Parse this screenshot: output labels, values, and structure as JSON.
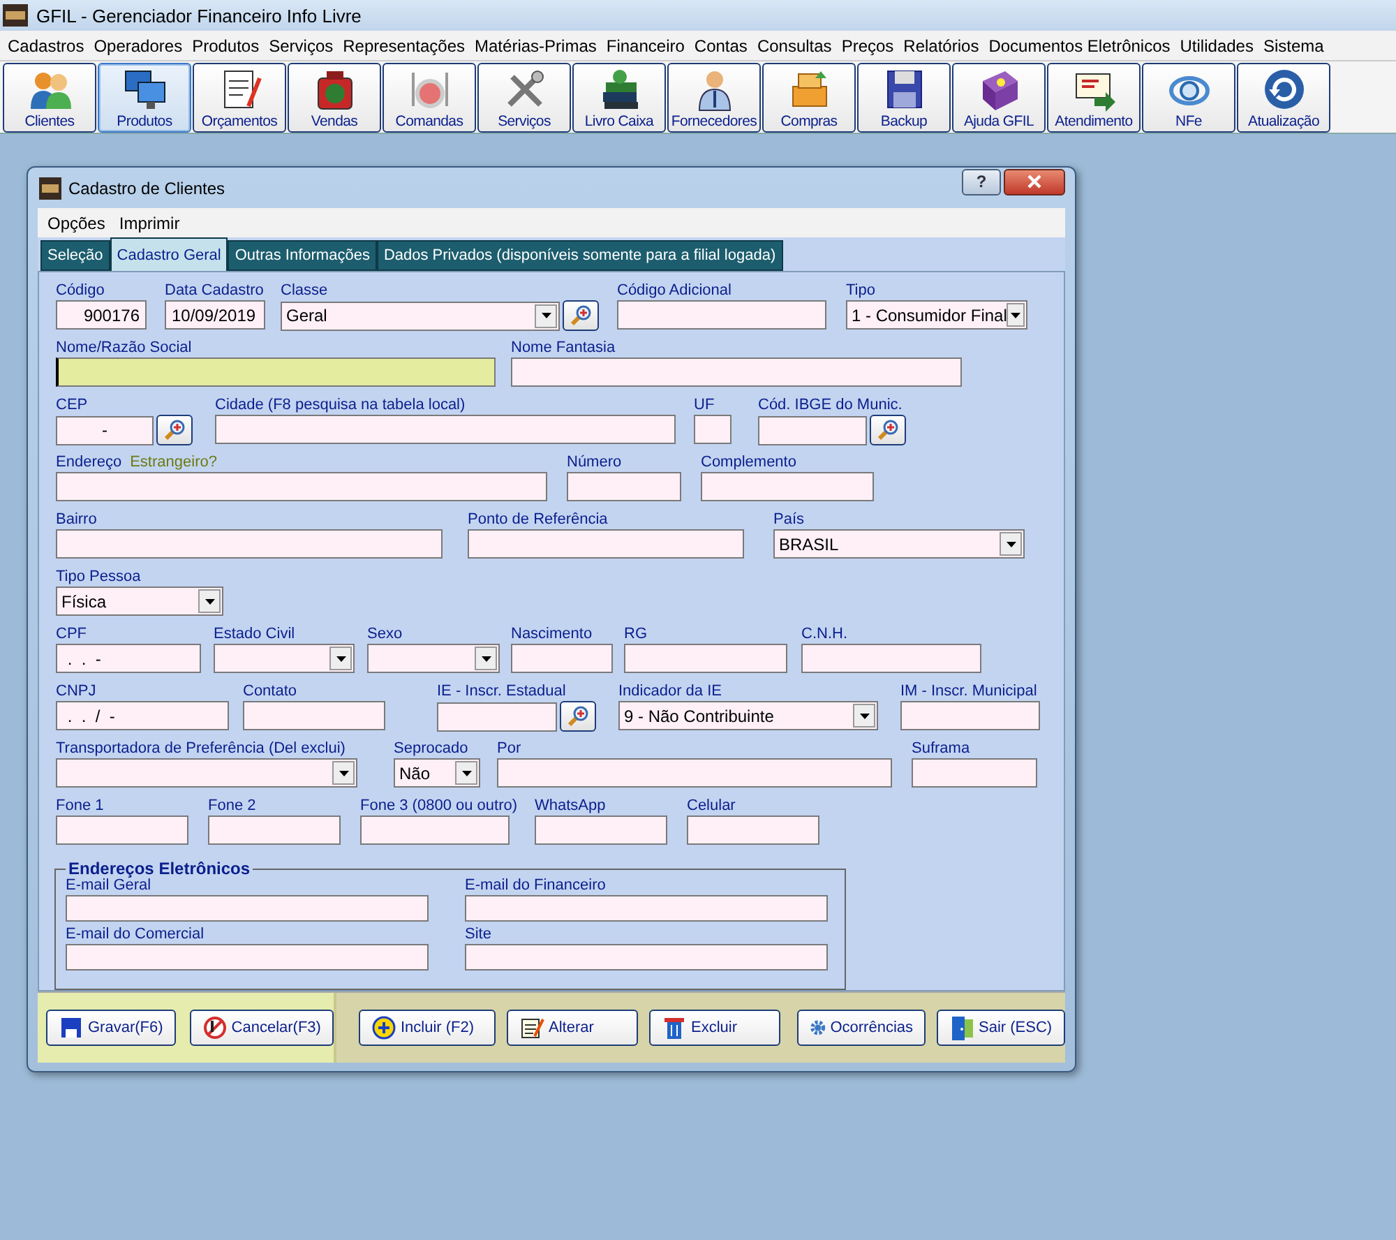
{
  "app_window": {
    "title": "GFIL - Gerenciador Financeiro Info Livre"
  },
  "menu": [
    "Cadastros",
    "Operadores",
    "Produtos",
    "Serviços",
    "Representações",
    "Matérias-Primas",
    "Financeiro",
    "Contas",
    "Consultas",
    "Preços",
    "Relatórios",
    "Documentos Eletrônicos",
    "Utilidades",
    "Sistema"
  ],
  "toolbar": [
    {
      "label": "Clientes",
      "selected": false
    },
    {
      "label": "Produtos",
      "selected": true
    },
    {
      "label": "Orçamentos",
      "selected": false
    },
    {
      "label": "Vendas",
      "selected": false
    },
    {
      "label": "Comandas",
      "selected": false
    },
    {
      "label": "Serviços",
      "selected": false
    },
    {
      "label": "Livro Caixa",
      "selected": false
    },
    {
      "label": "Fornecedores",
      "selected": false
    },
    {
      "label": "Compras",
      "selected": false
    },
    {
      "label": "Backup",
      "selected": false
    },
    {
      "label": "Ajuda GFIL",
      "selected": false
    },
    {
      "label": "Atendimento",
      "selected": false
    },
    {
      "label": "NFe",
      "selected": false
    },
    {
      "label": "Atualização",
      "selected": false
    }
  ],
  "dialog": {
    "title": "Cadastro de Clientes",
    "help_button": "?",
    "menu": [
      "Opções",
      "Imprimir"
    ],
    "tabs": [
      {
        "label": "Seleção",
        "selected": false
      },
      {
        "label": "Cadastro Geral",
        "selected": true
      },
      {
        "label": "Outras Informações",
        "selected": false
      },
      {
        "label": "Dados Privados (disponíveis somente para a filial logada)",
        "selected": false
      }
    ],
    "rows": [
      {
        "fields": [
          {
            "label": "Código",
            "kind": "text",
            "value": "900176",
            "focused": false
          },
          {
            "label": "Data Cadastro",
            "kind": "text",
            "value": "10/09/2019",
            "focused": false
          },
          {
            "label": "Classe",
            "kind": "combo",
            "value": "Geral",
            "lookup": true,
            "focused": false
          },
          {
            "label": "Código Adicional",
            "kind": "text",
            "focused": false
          },
          {
            "label": "Tipo",
            "kind": "combo",
            "value": "1 - Consumidor Final",
            "focused": false
          }
        ]
      },
      {
        "fields": [
          {
            "label": "Nome/Razão Social",
            "kind": "text",
            "focused": true
          },
          {
            "label": "Nome Fantasia",
            "kind": "text",
            "focused": false
          }
        ]
      },
      {
        "fields": [
          {
            "label": "CEP",
            "kind": "text",
            "value": "-",
            "lookup": true,
            "focused": false
          },
          {
            "label": "Cidade (F8 pesquisa na tabela local)",
            "kind": "text",
            "focused": false
          },
          {
            "label": "UF",
            "kind": "text",
            "focused": false
          },
          {
            "label": "Cód. IBGE do Munic.",
            "kind": "text",
            "lookup": true,
            "focused": false
          }
        ]
      },
      {
        "fields": [
          {
            "label": "Endereço",
            "note": "Estrangeiro?",
            "kind": "text",
            "focused": false
          },
          {
            "label": "Número",
            "kind": "text",
            "focused": false
          },
          {
            "label": "Complemento",
            "kind": "text",
            "focused": false
          }
        ]
      },
      {
        "fields": [
          {
            "label": "Bairro",
            "kind": "text",
            "focused": false
          },
          {
            "label": "Ponto de Referência",
            "kind": "text",
            "focused": false
          },
          {
            "label": "País",
            "kind": "combo",
            "value": "BRASIL",
            "focused": false
          }
        ]
      },
      {
        "fields": [
          {
            "label": "Tipo Pessoa",
            "kind": "combo",
            "value": "Física",
            "focused": false
          }
        ]
      },
      {
        "fields": [
          {
            "label": "CPF",
            "kind": "text",
            "value": " .  .  -",
            "focused": false
          },
          {
            "label": "Estado Civil",
            "kind": "combo",
            "focused": false
          },
          {
            "label": "Sexo",
            "kind": "combo",
            "focused": false
          },
          {
            "label": "Nascimento",
            "kind": "text",
            "focused": false
          },
          {
            "label": "RG",
            "kind": "text",
            "focused": false
          },
          {
            "label": "C.N.H.",
            "kind": "text",
            "focused": false
          }
        ]
      },
      {
        "fields": [
          {
            "label": "CNPJ",
            "kind": "text",
            "value": " .  .  /  -",
            "focused": false
          },
          {
            "label": "Contato",
            "kind": "text",
            "focused": false
          },
          {
            "label": "IE - Inscr. Estadual",
            "kind": "text",
            "lookup": true,
            "focused": false
          },
          {
            "label": "Indicador da IE",
            "kind": "combo",
            "value": "9 - Não Contribuinte",
            "focused": false
          },
          {
            "label": "IM - Inscr. Municipal",
            "kind": "text",
            "focused": false
          }
        ]
      },
      {
        "fields": [
          {
            "label": "Transportadora de Preferência (Del exclui)",
            "kind": "combo",
            "focused": false
          },
          {
            "label": "Seprocado",
            "kind": "combo",
            "value": "Não",
            "focused": false
          },
          {
            "label": "Por",
            "kind": "text",
            "focused": false
          },
          {
            "label": "Suframa",
            "kind": "text",
            "focused": false
          }
        ]
      },
      {
        "fields": [
          {
            "label": "Fone 1",
            "kind": "text",
            "focused": false
          },
          {
            "label": "Fone 2",
            "kind": "text",
            "focused": false
          },
          {
            "label": "Fone 3 (0800 ou outro)",
            "kind": "text",
            "focused": false
          },
          {
            "label": "WhatsApp",
            "kind": "text",
            "focused": false
          },
          {
            "label": "Celular",
            "kind": "text",
            "focused": false
          }
        ]
      }
    ],
    "group": {
      "title": "Endereços Eletrônicos",
      "fields": [
        {
          "label": "E-mail Geral"
        },
        {
          "label": "E-mail do Financeiro"
        },
        {
          "label": "E-mail do Comercial"
        },
        {
          "label": "Site"
        }
      ]
    },
    "buttons_left": [
      "Gravar(F6)",
      "Cancelar(F3)"
    ],
    "buttons_right": [
      "Incluir (F2)",
      "Alterar",
      "Excluir",
      "Ocorrências",
      "Sair (ESC)"
    ]
  }
}
